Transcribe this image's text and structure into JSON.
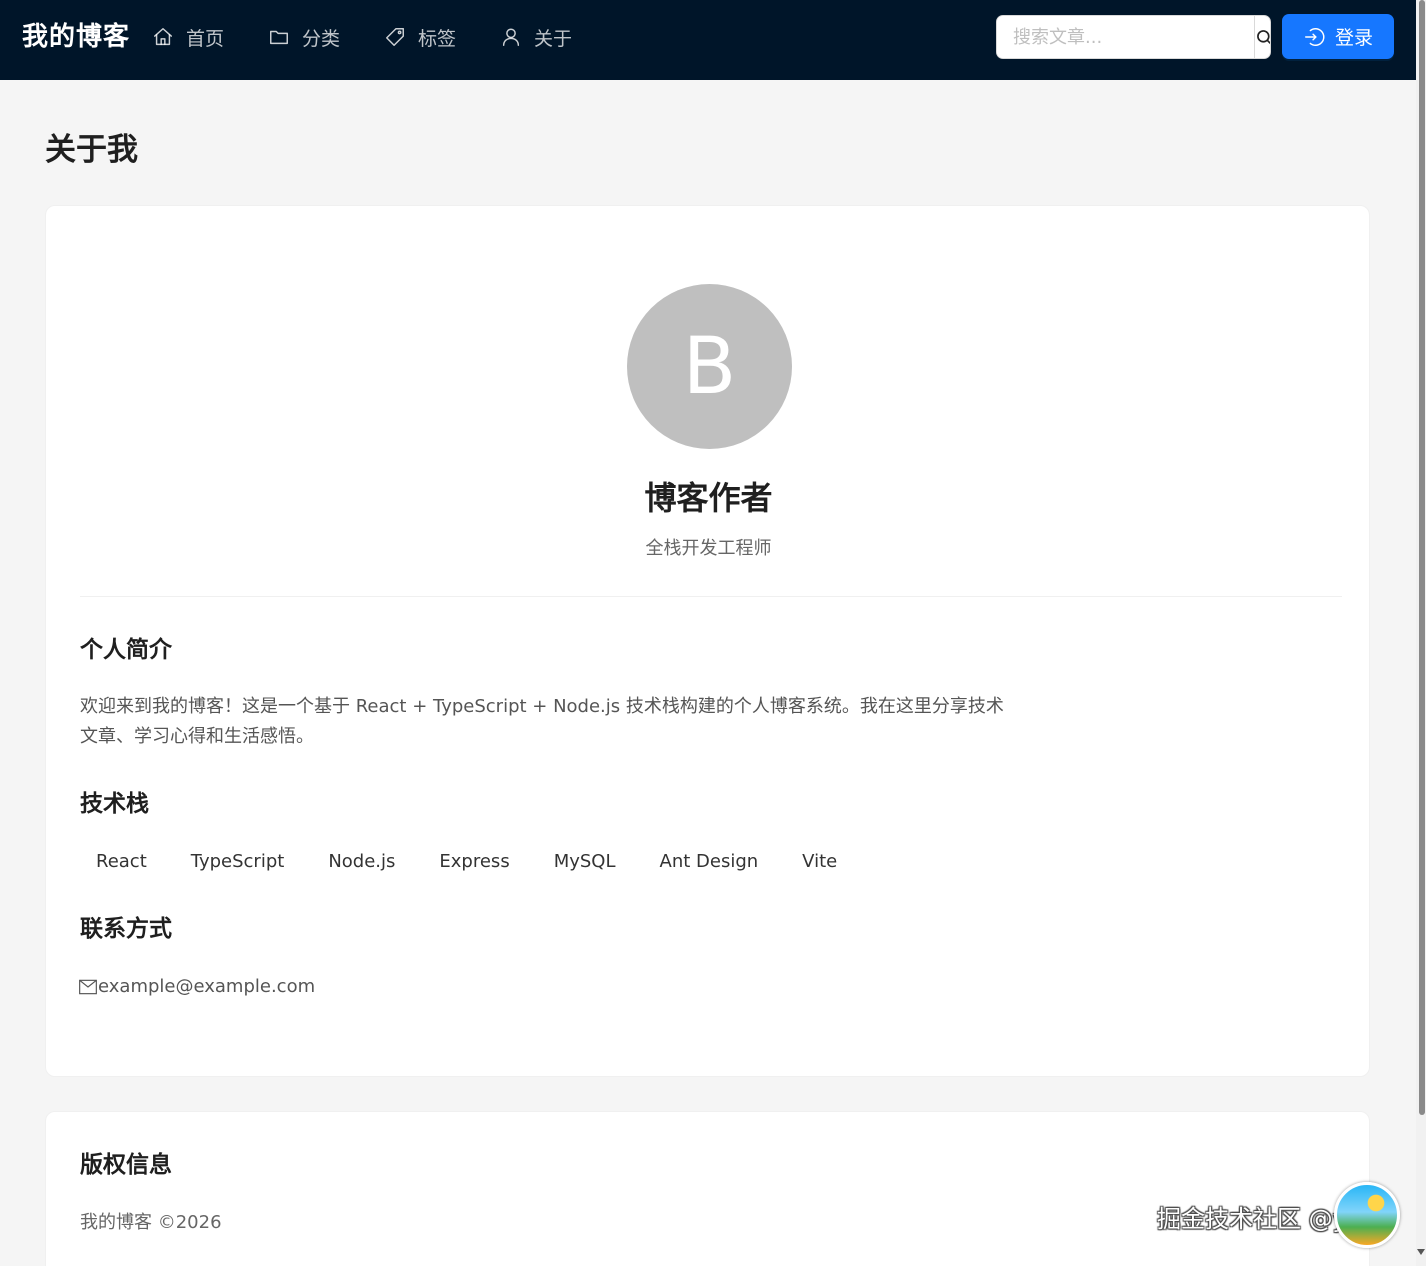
{
  "header": {
    "brand": "我的博客",
    "nav": [
      {
        "label": "首页",
        "icon": "home-icon"
      },
      {
        "label": "分类",
        "icon": "folder-icon"
      },
      {
        "label": "标签",
        "icon": "tag-icon"
      },
      {
        "label": "关于",
        "icon": "user-icon"
      }
    ],
    "search_placeholder": "搜索文章...",
    "login_label": "登录"
  },
  "page": {
    "title": "关于我"
  },
  "profile": {
    "avatar_letter": "B",
    "name": "博客作者",
    "role": "全栈开发工程师"
  },
  "intro": {
    "title": "个人简介",
    "text": "欢迎来到我的博客！这是一个基于 React + TypeScript + Node.js 技术栈构建的个人博客系统。我在这里分享技术文章、学习心得和生活感悟。"
  },
  "tech": {
    "title": "技术栈",
    "tags": [
      "React",
      "TypeScript",
      "Node.js",
      "Express",
      "MySQL",
      "Ant Design",
      "Vite"
    ]
  },
  "contact": {
    "title": "联系方式",
    "email": "example@example.com"
  },
  "copyright": {
    "title": "版权信息",
    "text": "我的博客 ©2026"
  },
  "watermark": {
    "text": "掘金技术社区 @yyt_"
  },
  "colors": {
    "header_bg": "#001529",
    "primary": "#1677ff",
    "page_bg": "#f5f5f5",
    "avatar_bg": "#bfbfbf"
  }
}
